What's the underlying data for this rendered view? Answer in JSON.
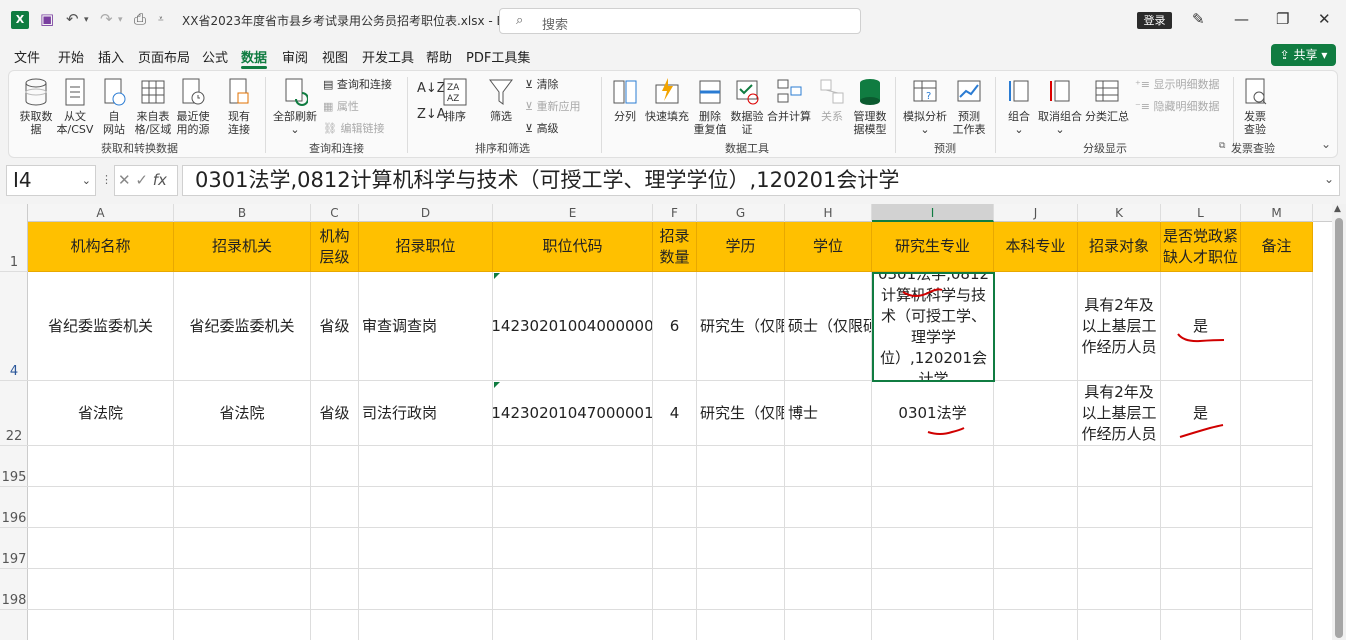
{
  "titlebar": {
    "app_icon": "X",
    "doc_title": "XX省2023年度省市县乡考试录用公务员招考职位表.xlsx  -  Ex...",
    "search_placeholder": "搜索",
    "login": "登录"
  },
  "menu": [
    "文件",
    "开始",
    "插入",
    "页面布局",
    "公式",
    "数据",
    "审阅",
    "视图",
    "开发工具",
    "帮助",
    "PDF工具集"
  ],
  "active_menu": "数据",
  "share_label": "共享",
  "ribbon": {
    "get_data": {
      "label": "获取数\n据",
      "group": "获取和转换数据"
    },
    "from_text": "从文\n本/CSV",
    "from_web": "自\n网站",
    "from_table": "来自表\n格/区域",
    "recent_sources": "最近使\n用的源",
    "existing_conn": "现有\n连接",
    "refresh_all": "全部刷新",
    "queries_conn": "查询和连接",
    "properties": "属性",
    "edit_links": "编辑链接",
    "queries_group": "查询和连接",
    "sort": "排序",
    "filter": "筛选",
    "clear": "清除",
    "reapply": "重新应用",
    "advanced": "高级",
    "sort_filter_group": "排序和筛选",
    "text_to_cols": "分列",
    "flash_fill": "快速填充",
    "remove_dup": "删除\n重复值",
    "data_validation": "数据验\n证",
    "consolidate": "合并计算",
    "relationships": "关系",
    "data_model": "管理数\n据模型",
    "data_tools_group": "数据工具",
    "what_if": "模拟分析",
    "forecast_sheet": "预测\n工作表",
    "forecast_group": "预测",
    "group": "组合",
    "ungroup": "取消组合",
    "subtotal": "分类汇总",
    "show_detail": "显示明细数据",
    "hide_detail": "隐藏明细数据",
    "outline_group": "分级显示",
    "invoice_check": "发票\n查验",
    "invoice_group": "发票查验"
  },
  "formula_bar": {
    "name_box": "I4",
    "fx": "fx",
    "content": "0301法学,0812计算机科学与技术（可授工学、理学学位）,120201会计学"
  },
  "columns": [
    "A",
    "B",
    "C",
    "D",
    "E",
    "F",
    "G",
    "H",
    "I",
    "J",
    "K",
    "L",
    "M"
  ],
  "selected_column": "I",
  "rows": [
    "1",
    "4",
    "22",
    "195",
    "196",
    "197",
    "198"
  ],
  "header_row": [
    "机构名称",
    "招录机关",
    "机构层级",
    "招录职位",
    "职位代码",
    "招录数量",
    "学历",
    "学位",
    "研究生专业",
    "本科专业",
    "招录对象",
    "是否党政紧缺人才职位",
    "备注"
  ],
  "data_rows": [
    [
      "省纪委监委机关",
      "省纪委监委机关",
      "省级",
      "审查调查岗",
      "14230201004000000",
      "6",
      "研究生（仅限",
      "硕士（仅限硕",
      "0301法学,0812计算机科学与技术（可授工学、理学学位）,120201会计学",
      "",
      "具有2年及以上基层工作经历人员",
      "是",
      ""
    ],
    [
      "省法院",
      "省法院",
      "省级",
      "司法行政岗",
      "14230201047000001",
      "4",
      "研究生（仅限",
      "博士",
      "0301法学",
      "",
      "具有2年及以上基层工作经历人员",
      "是",
      ""
    ]
  ],
  "colors": {
    "accent": "#107c41",
    "header_fill": "#ffc000",
    "ink": "#d00000"
  }
}
